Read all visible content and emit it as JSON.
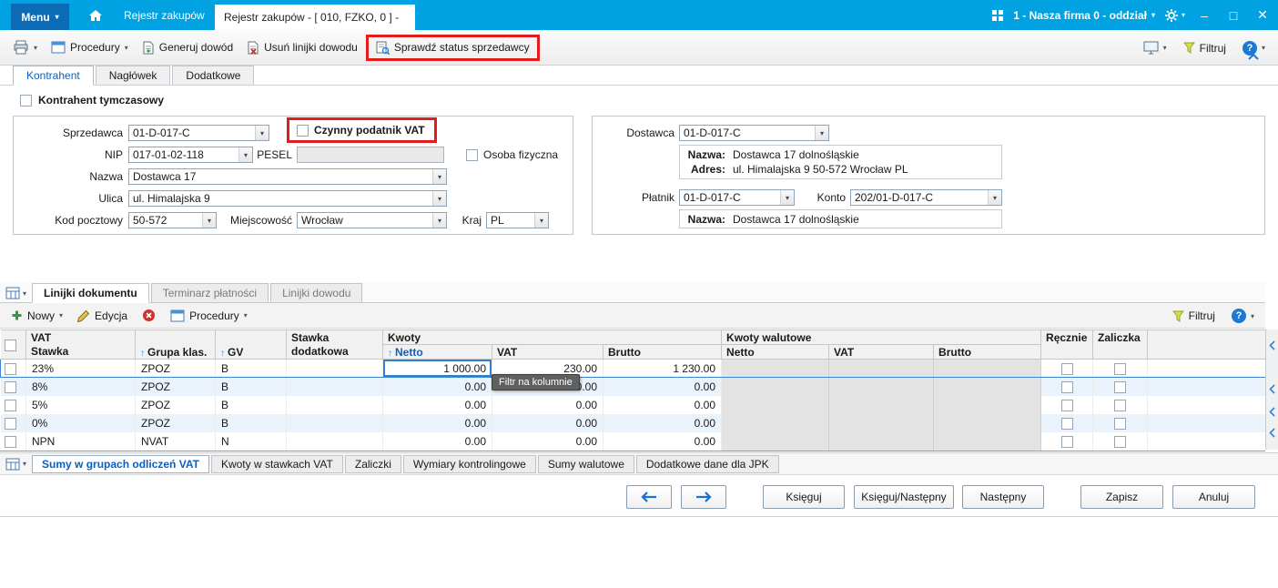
{
  "titlebar": {
    "menu_label": "Menu",
    "home_tab": "Rejestr zakupów",
    "active_tab": "Rejestr zakupów - [ 010, FZKO, 0 ] -",
    "company": "1 - Nasza firma 0 - oddział"
  },
  "toolbar": {
    "procedury": "Procedury",
    "generuj_dowod": "Generuj dowód",
    "usun_linijki": "Usuń linijki dowodu",
    "sprawdz_status": "Sprawdź status sprzedawcy",
    "filtruj": "Filtruj"
  },
  "tabs": {
    "kontrahent": "Kontrahent",
    "naglowek": "Nagłówek",
    "dodatkowe": "Dodatkowe"
  },
  "form": {
    "kontrahent_tymczasowy": "Kontrahent tymczasowy",
    "sprzedawca_label": "Sprzedawca",
    "sprzedawca_value": "01-D-017-C",
    "czynny_podatnik_label": "Czynny podatnik VAT",
    "nip_label": "NIP",
    "nip_value": "017-01-02-118",
    "pesel_label": "PESEL",
    "pesel_value": "",
    "osoba_fizyczna_label": "Osoba fizyczna",
    "nazwa_label": "Nazwa",
    "nazwa_value": "Dostawca 17",
    "ulica_label": "Ulica",
    "ulica_value": "ul. Himalajska 9",
    "kod_pocztowy_label": "Kod pocztowy",
    "kod_pocztowy_value": "50-572",
    "miejscowosc_label": "Miejscowość",
    "miejscowosc_value": "Wrocław",
    "kraj_label": "Kraj",
    "kraj_value": "PL"
  },
  "supplier_panel": {
    "dostawca_label": "Dostawca",
    "dostawca_value": "01-D-017-C",
    "nazwa_label": "Nazwa:",
    "nazwa_value": "Dostawca 17 dolnośląskie",
    "adres_label": "Adres:",
    "adres_value": "ul. Himalajska 9 50-572 Wrocław PL",
    "platnik_label": "Płatnik",
    "platnik_value": "01-D-017-C",
    "konto_label": "Konto",
    "konto_value": "202/01-D-017-C",
    "platnik_nazwa_label": "Nazwa:",
    "platnik_nazwa_value": "Dostawca 17 dolnośląskie"
  },
  "grid_section": {
    "tabs": {
      "linijki_dokumentu": "Linijki dokumentu",
      "terminarz": "Terminarz płatności",
      "linijki_dowodu": "Linijki dowodu"
    },
    "toolbar": {
      "nowy": "Nowy",
      "edycja": "Edycja",
      "procedury": "Procedury",
      "filtruj": "Filtruj"
    },
    "tooltip": "Filtr na kolumnie"
  },
  "table": {
    "header": {
      "vat": "VAT",
      "stawka": "Stawka",
      "grupa_klas": "Grupa klas.",
      "gv": "GV",
      "stawka_dodatkowa_1": "Stawka",
      "stawka_dodatkowa_2": "dodatkowa",
      "kwoty": "Kwoty",
      "kwoty_walutowe": "Kwoty walutowe",
      "netto": "Netto",
      "vat2": "VAT",
      "brutto": "Brutto",
      "w_netto": "Netto",
      "w_vat": "VAT",
      "w_brutto": "Brutto",
      "recznie": "Ręcznie",
      "zaliczka": "Zaliczka"
    },
    "rows": [
      {
        "stawka": "23%",
        "grupa": "ZPOZ",
        "gv": "B",
        "netto": "1 000.00",
        "vat": "230.00",
        "brutto": "1 230.00"
      },
      {
        "stawka": "8%",
        "grupa": "ZPOZ",
        "gv": "B",
        "netto": "0.00",
        "vat": "0.00",
        "brutto": "0.00"
      },
      {
        "stawka": "5%",
        "grupa": "ZPOZ",
        "gv": "B",
        "netto": "0.00",
        "vat": "0.00",
        "brutto": "0.00"
      },
      {
        "stawka": "0%",
        "grupa": "ZPOZ",
        "gv": "B",
        "netto": "0.00",
        "vat": "0.00",
        "brutto": "0.00"
      },
      {
        "stawka": "NPN",
        "grupa": "NVAT",
        "gv": "N",
        "netto": "0.00",
        "vat": "0.00",
        "brutto": "0.00"
      }
    ]
  },
  "bottom_tabs": {
    "sumy_vat": "Sumy w grupach odliczeń VAT",
    "kwoty_stawki": "Kwoty w stawkach VAT",
    "zaliczki": "Zaliczki",
    "wymiary": "Wymiary kontrolingowe",
    "sumy_walutowe": "Sumy walutowe",
    "jpk": "Dodatkowe dane dla JPK"
  },
  "actions": {
    "ksieguj": "Księguj",
    "ksieguj_nastepny": "Księguj/Następny",
    "nastepny": "Następny",
    "zapisz": "Zapisz",
    "anuluj": "Anuluj"
  },
  "colors": {
    "titlebar_blue": "#00a2e1",
    "accent_blue": "#0a5fc0",
    "annotation_red": "#e41c1c",
    "selected_row_blue": "#3a86d4"
  }
}
